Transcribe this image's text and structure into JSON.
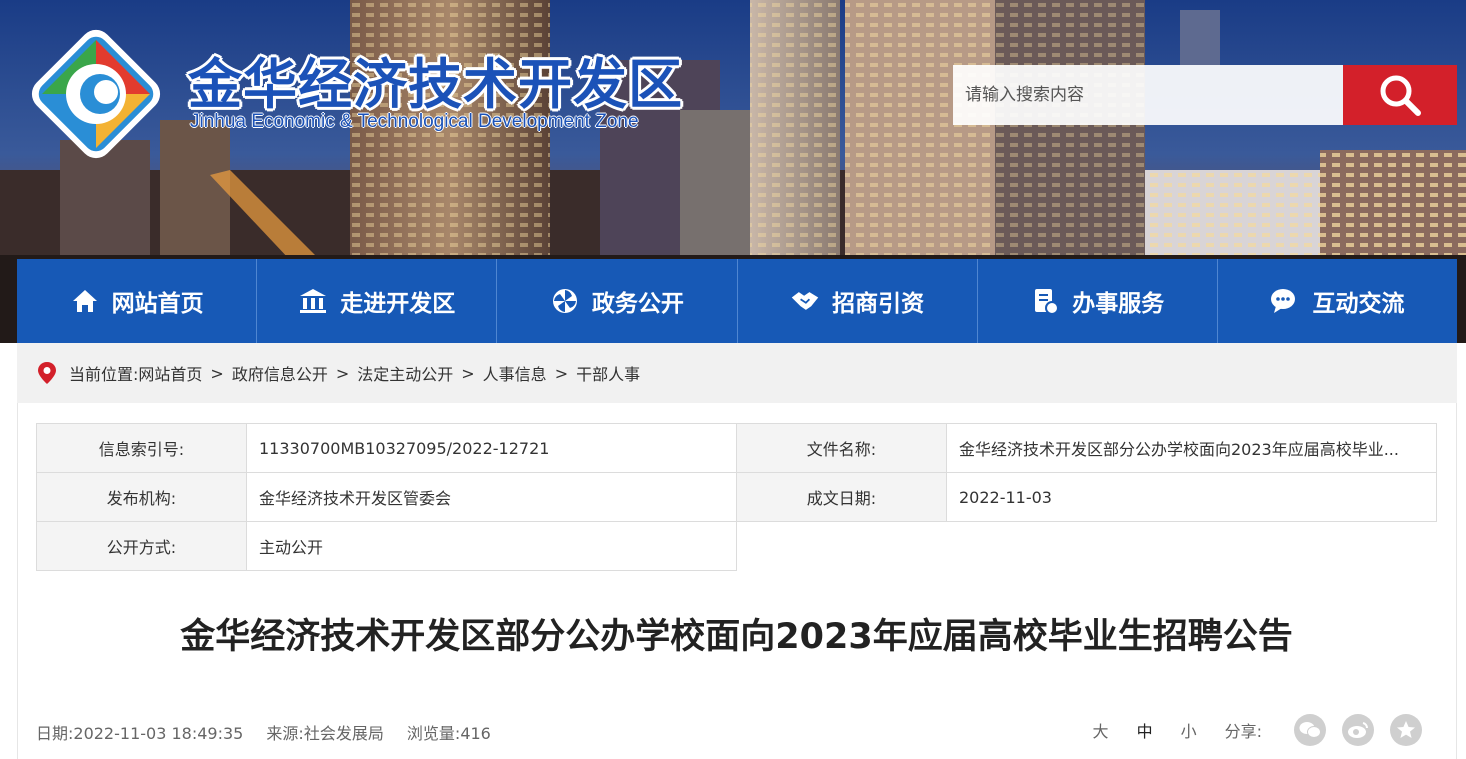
{
  "header": {
    "site_name_cn": "金华经济技术开发区",
    "site_name_en": "Jinhua Economic & Technological Development Zone",
    "search_placeholder": "请输入搜索内容"
  },
  "nav": {
    "items": [
      {
        "label": "网站首页",
        "icon": "home-icon"
      },
      {
        "label": "走进开发区",
        "icon": "building-icon"
      },
      {
        "label": "政务公开",
        "icon": "pinwheel-icon"
      },
      {
        "label": "招商引资",
        "icon": "handshake-icon"
      },
      {
        "label": "办事服务",
        "icon": "document-icon"
      },
      {
        "label": "互动交流",
        "icon": "chat-icon"
      }
    ]
  },
  "breadcrumb": {
    "prefix": "当前位置:",
    "items": [
      "网站首页",
      "政府信息公开",
      "法定主动公开",
      "人事信息",
      "干部人事"
    ]
  },
  "meta": {
    "index_label": "信息索引号:",
    "index_value": "11330700MB10327095/2022-12721",
    "filename_label": "文件名称:",
    "filename_value": "金华经济技术开发区部分公办学校面向2023年应届高校毕业...",
    "publisher_label": "发布机构:",
    "publisher_value": "金华经济技术开发区管委会",
    "date_label": "成文日期:",
    "date_value": "2022-11-03",
    "method_label": "公开方式:",
    "method_value": "主动公开"
  },
  "article": {
    "title": "金华经济技术开发区部分公办学校面向2023年应届高校毕业生招聘公告",
    "date": "日期:2022-11-03 18:49:35",
    "source": "来源:社会发展局",
    "views": "浏览量:416"
  },
  "tools": {
    "size_large": "大",
    "size_medium": "中",
    "size_small": "小",
    "share_label": "分享:"
  },
  "colors": {
    "nav_bg": "#1759b6",
    "search_btn": "#d3202a",
    "logo_blue": "#1b52b8"
  }
}
